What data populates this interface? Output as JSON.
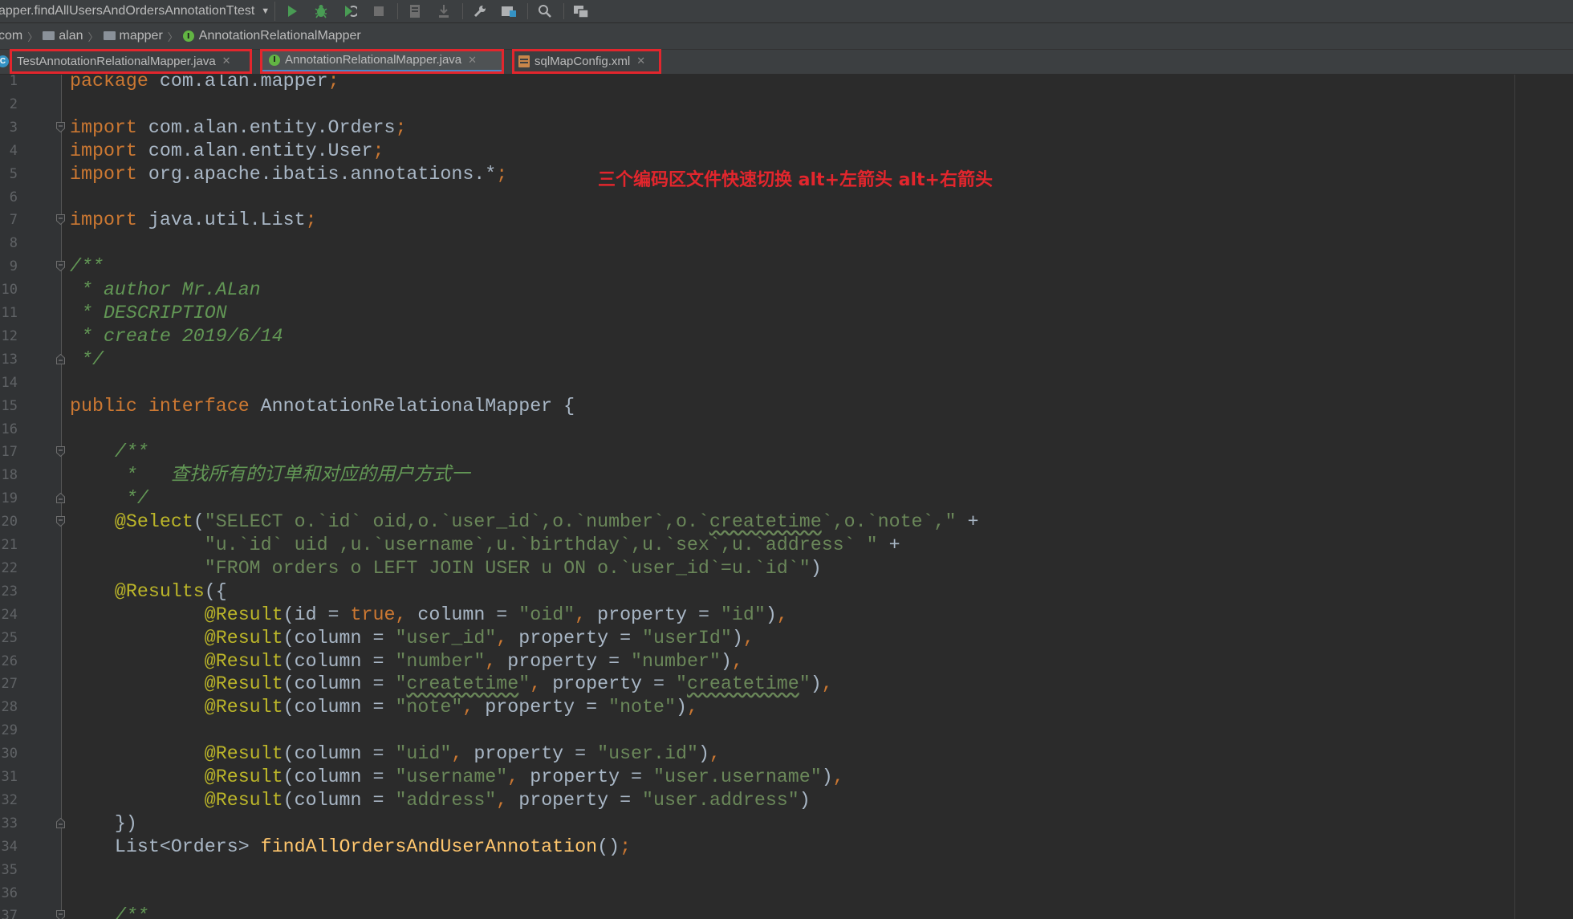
{
  "toolbar": {
    "run_config": "apper.findAllUsersAndOrdersAnnotationTtest",
    "buttons": [
      {
        "name": "run-icon",
        "color": "#499c54"
      },
      {
        "name": "debug-icon",
        "color": "#499c54"
      },
      {
        "name": "coverage-icon",
        "color": "#499c54"
      },
      {
        "name": "stop-icon",
        "color": "#6e6e6e"
      },
      {
        "name": "build-icon",
        "color": "#6e6e6e"
      },
      {
        "name": "download-icon",
        "color": "#6e6e6e"
      },
      {
        "name": "wrench-icon",
        "color": "#afb1b3"
      },
      {
        "name": "project-structure-icon",
        "color": "#afb1b3"
      },
      {
        "name": "search-icon",
        "color": "#afb1b3"
      },
      {
        "name": "services-icon",
        "color": "#afb1b3"
      }
    ]
  },
  "breadcrumb": {
    "items": [
      "com",
      "alan",
      "mapper",
      "AnnotationRelationalMapper"
    ]
  },
  "tabs": [
    {
      "label": "TestAnnotationRelationalMapper.java",
      "active": false
    },
    {
      "label": "AnnotationRelationalMapper.java",
      "active": true
    },
    {
      "label": "sqlMapConfig.xml",
      "active": false
    }
  ],
  "callout": "三个编码区文件快速切换 alt+左箭头  alt+右箭头",
  "editor": {
    "line_numbers": [
      "1",
      "2",
      "3",
      "4",
      "5",
      "6",
      "7",
      "8",
      "9",
      "10",
      "11",
      "12",
      "13",
      "14",
      "15",
      "16",
      "17",
      "18",
      "19",
      "20",
      "21",
      "22",
      "23",
      "24",
      "25",
      "26",
      "27",
      "28",
      "29",
      "30",
      "31",
      "32",
      "33",
      "34",
      "35",
      "36",
      "37"
    ],
    "colors": {
      "keyword": "#cc7832",
      "string": "#6a8759",
      "comment": "#629755",
      "annotation": "#bbb529",
      "method": "#ffc66d",
      "text": "#a9b7c6",
      "highlight_border": "#e3262d"
    }
  }
}
